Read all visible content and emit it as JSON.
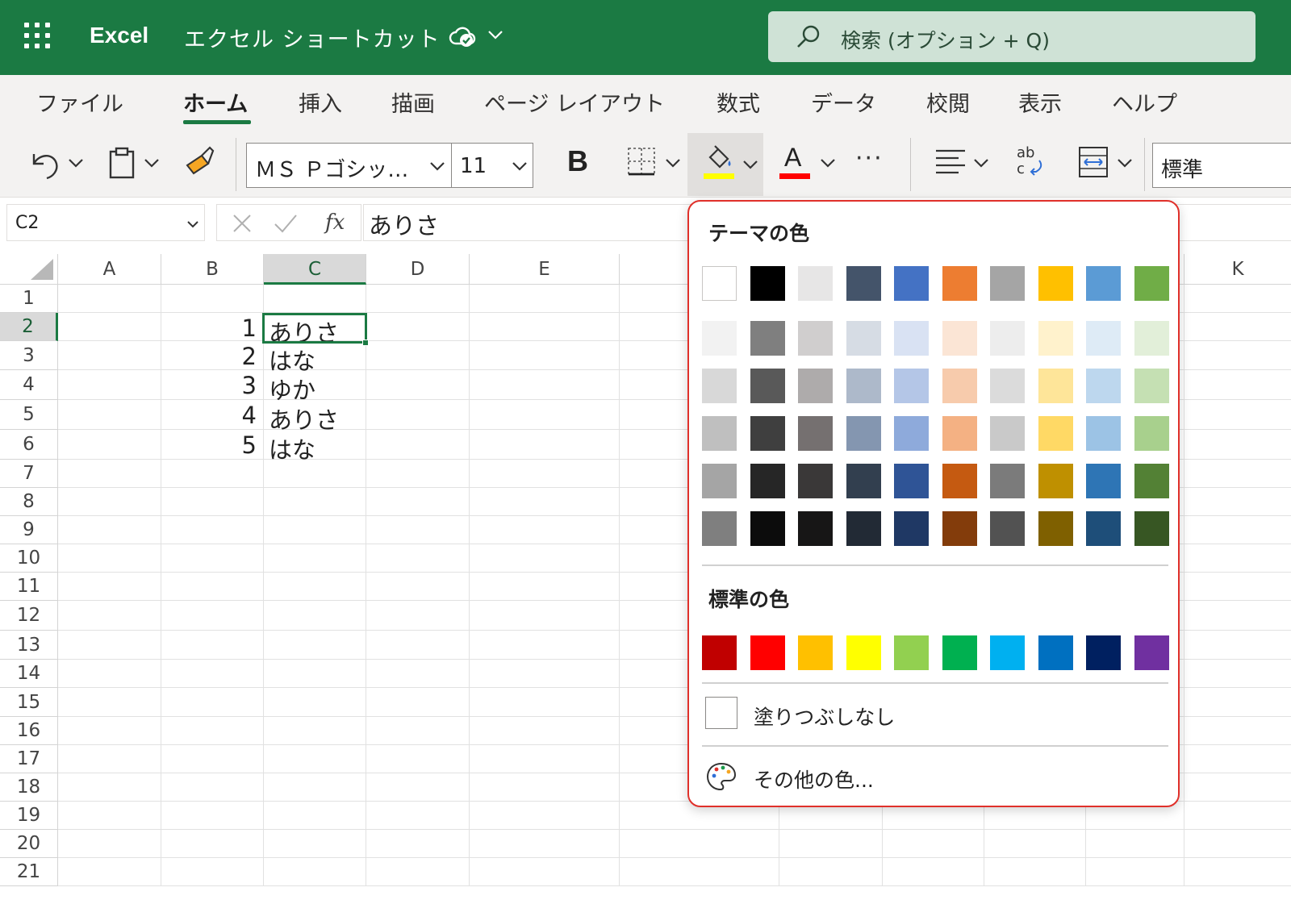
{
  "titlebar": {
    "app_name": "Excel",
    "doc_title": "エクセル ショートカット",
    "search_placeholder": "検索 (オプション + Q)",
    "bg_color": "#1b7a43"
  },
  "tabs": [
    {
      "label": "ファイル",
      "active": false
    },
    {
      "label": "ホーム",
      "active": true
    },
    {
      "label": "挿入",
      "active": false
    },
    {
      "label": "描画",
      "active": false
    },
    {
      "label": "ページ レイアウト",
      "active": false
    },
    {
      "label": "数式",
      "active": false
    },
    {
      "label": "データ",
      "active": false
    },
    {
      "label": "校閲",
      "active": false
    },
    {
      "label": "表示",
      "active": false
    },
    {
      "label": "ヘルプ",
      "active": false
    }
  ],
  "ribbon": {
    "font_name": "ＭＳ Ｐゴシッ…",
    "font_size": "11",
    "bold_label": "B",
    "font_color_label": "A",
    "number_format": "標準",
    "more_label": "···",
    "fill_color": "#ffff00",
    "font_color": "#ff0000"
  },
  "formula_bar": {
    "name_box": "C2",
    "fx_label": "fx",
    "content": "ありさ"
  },
  "sheet": {
    "columns": [
      "A",
      "B",
      "C",
      "D",
      "E",
      "K"
    ],
    "selected_column": "C",
    "rows": [
      "1",
      "2",
      "3",
      "4",
      "5",
      "6",
      "7",
      "8",
      "9",
      "10",
      "11",
      "12",
      "13",
      "14",
      "15",
      "16",
      "17",
      "18",
      "19",
      "20",
      "21"
    ],
    "selected_row": "2",
    "data": [
      {
        "row": 2,
        "b": "1",
        "c": "ありさ"
      },
      {
        "row": 3,
        "b": "2",
        "c": "はな"
      },
      {
        "row": 4,
        "b": "3",
        "c": "ゆか"
      },
      {
        "row": 5,
        "b": "4",
        "c": "ありさ"
      },
      {
        "row": 6,
        "b": "5",
        "c": "はな"
      }
    ]
  },
  "color_menu": {
    "theme_heading": "テーマの色",
    "standard_heading": "標準の色",
    "no_fill_label": "塗りつぶしなし",
    "more_colors_label": "その他の色...",
    "theme_colors": [
      [
        "#ffffff",
        "#000000",
        "#e7e6e6",
        "#44546a",
        "#4472c4",
        "#ed7d31",
        "#a5a5a5",
        "#ffc000",
        "#5b9bd5",
        "#70ad47"
      ],
      [
        "#f2f2f2",
        "#7f7f7f",
        "#d0cece",
        "#d6dce4",
        "#d9e2f3",
        "#fbe5d5",
        "#ededed",
        "#fff2cc",
        "#deebf6",
        "#e2efd9"
      ],
      [
        "#d8d8d8",
        "#595959",
        "#aeabab",
        "#adb9ca",
        "#b4c6e7",
        "#f7cbac",
        "#dbdbdb",
        "#fee599",
        "#bdd7ee",
        "#c5e0b3"
      ],
      [
        "#bfbfbf",
        "#3f3f3f",
        "#757070",
        "#8496b0",
        "#8eaadb",
        "#f4b183",
        "#c9c9c9",
        "#ffd965",
        "#9cc3e5",
        "#a8d08d"
      ],
      [
        "#a5a5a5",
        "#262626",
        "#3a3838",
        "#323f4f",
        "#2f5496",
        "#c55a11",
        "#7b7b7b",
        "#bf9000",
        "#2e75b5",
        "#538135"
      ],
      [
        "#7f7f7f",
        "#0c0c0c",
        "#171616",
        "#222a35",
        "#1f3864",
        "#833c0b",
        "#525252",
        "#7f6000",
        "#1e4e79",
        "#375623"
      ]
    ],
    "standard_colors": [
      "#c00000",
      "#ff0000",
      "#ffc000",
      "#ffff00",
      "#92d050",
      "#00b050",
      "#00b0f0",
      "#0070c0",
      "#002060",
      "#7030a0"
    ]
  }
}
